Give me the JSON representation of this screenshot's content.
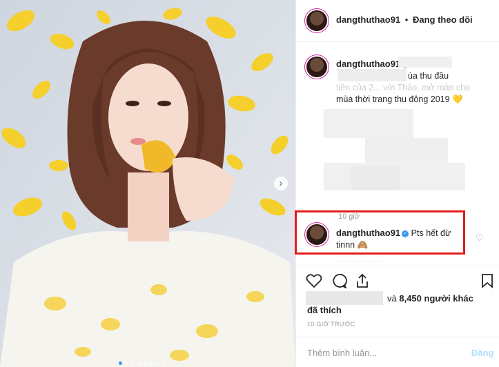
{
  "header": {
    "username": "dangthuthao91",
    "separator": "•",
    "follow_status": "Đang theo dõi"
  },
  "caption": {
    "username": "dangthuthao91",
    "verified_mark": "✓",
    "text_line1": "ùa thu đầu",
    "text_line2": "tiên của 2... với Thảo, mở màn cho",
    "text_line3": "mùa thời trang thu đông 2019",
    "heart_emoji": "💛"
  },
  "timestamp_caption": "10 giờ",
  "comment": {
    "username": "dangthuthao91",
    "verified_mark": "✓",
    "text_line1": "Pts hết đừ",
    "text_line2": "tinnn",
    "emoji": "🙈",
    "reply_meta": "···· · ······ ···· ··"
  },
  "likes": {
    "and_text": "và",
    "count_text": "8,450 người khác",
    "liked_text": "đã thích"
  },
  "post_time": "10 GIỜ TRƯỚC",
  "comment_input": {
    "placeholder": "Thêm bình luận...",
    "post_button": "Đăng"
  },
  "carousel": {
    "dot_count": 8,
    "active_index": 0
  }
}
